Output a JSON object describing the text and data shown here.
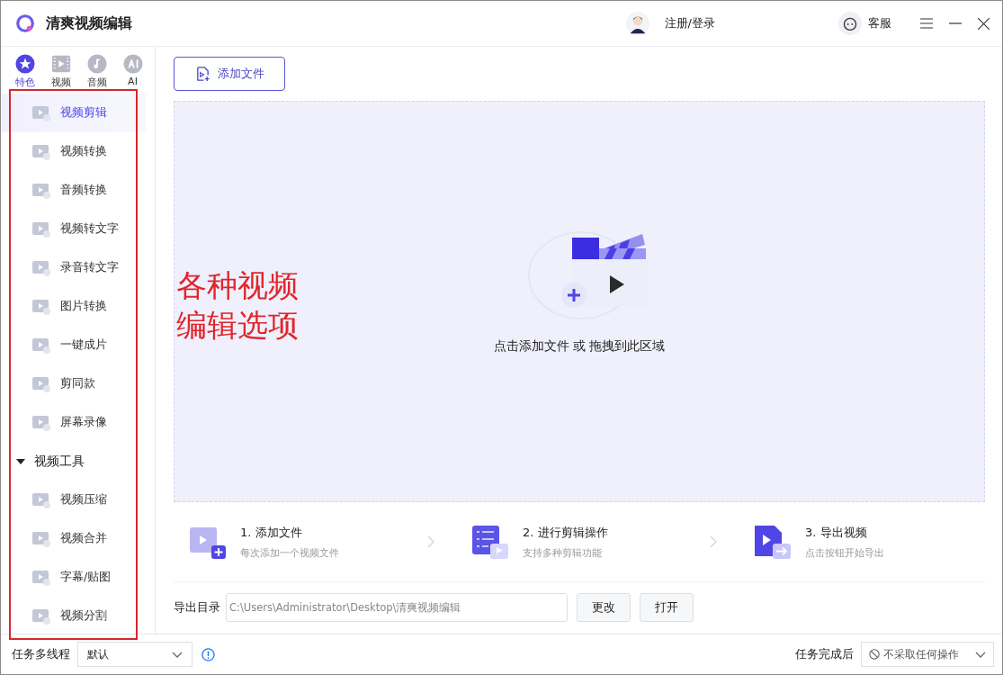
{
  "app": {
    "title": "清爽视频编辑"
  },
  "header": {
    "login": "注册/登录",
    "service": "客服"
  },
  "category_tabs": [
    {
      "label": "特色",
      "selected": true,
      "kind": "star"
    },
    {
      "label": "视频",
      "selected": false,
      "kind": "video"
    },
    {
      "label": "音频",
      "selected": false,
      "kind": "audio"
    },
    {
      "label": "AI",
      "selected": false,
      "kind": "ai"
    }
  ],
  "sidebar": {
    "items": [
      {
        "label": "视频剪辑",
        "selected": true
      },
      {
        "label": "视频转换",
        "selected": false
      },
      {
        "label": "音频转换",
        "selected": false
      },
      {
        "label": "视频转文字",
        "selected": false
      },
      {
        "label": "录音转文字",
        "selected": false
      },
      {
        "label": "图片转换",
        "selected": false
      },
      {
        "label": "一键成片",
        "selected": false
      },
      {
        "label": "剪同款",
        "selected": false
      },
      {
        "label": "屏幕录像",
        "selected": false
      }
    ],
    "group": {
      "label": "视频工具",
      "expanded": true,
      "items": [
        {
          "label": "视频压缩",
          "selected": false
        },
        {
          "label": "视频合并",
          "selected": false
        },
        {
          "label": "字幕/贴图",
          "selected": false
        },
        {
          "label": "视频分割",
          "selected": false
        }
      ]
    }
  },
  "add_file_button": "添加文件",
  "drop_zone": {
    "hint": "点击添加文件 或 拖拽到此区域"
  },
  "steps": [
    {
      "kind": "add",
      "title": "1. 添加文件",
      "subtitle": "每次添加一个视频文件"
    },
    {
      "kind": "edit",
      "title": "2. 进行剪辑操作",
      "subtitle": "支持多种剪辑功能"
    },
    {
      "kind": "export",
      "title": "3. 导出视频",
      "subtitle": "点击按钮开始导出"
    }
  ],
  "export": {
    "label": "导出目录",
    "value": "C:\\Users\\Administrator\\Desktop\\清爽视频编辑",
    "buttons": [
      "更改",
      "打开"
    ]
  },
  "status_bar": {
    "threads_label": "任务多线程",
    "threads_value": "默认",
    "after_label": "任务完成后",
    "after_value": "不采取任何操作"
  },
  "annotation": {
    "lines": [
      "各种视频",
      "编辑选项"
    ]
  }
}
